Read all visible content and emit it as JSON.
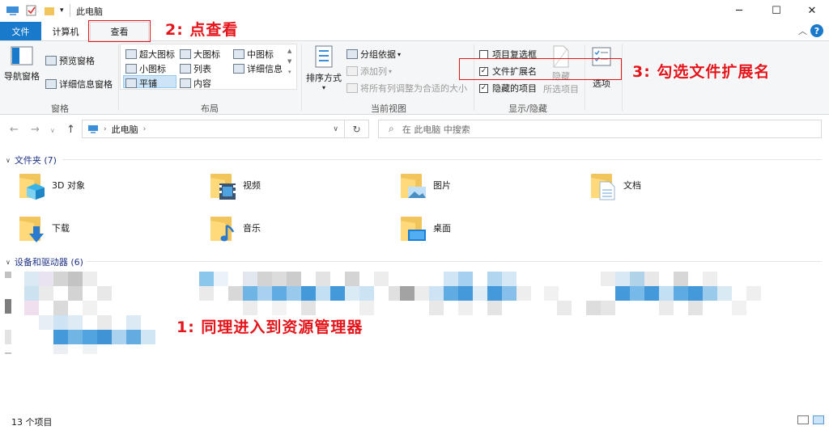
{
  "window": {
    "title": "此电脑",
    "controls": [
      "─",
      "☐",
      "✕"
    ]
  },
  "tabs": {
    "file": "文件",
    "computer": "计算机",
    "view": "查看"
  },
  "ribbon": {
    "panes": {
      "nav_pane": "导航窗格",
      "preview_pane": "预览窗格",
      "details_pane": "详细信息窗格",
      "label": "窗格"
    },
    "layout": {
      "items": [
        "超大图标",
        "大图标",
        "中图标",
        "小图标",
        "列表",
        "详细信息",
        "平铺",
        "内容"
      ],
      "label": "布局"
    },
    "current_view": {
      "sort": "排序方式",
      "group_by": "分组依据",
      "add_column": "添加列",
      "fit_columns": "将所有列调整为合适的大小",
      "label": "当前视图"
    },
    "show_hide": {
      "item_checkboxes": "项目复选框",
      "file_extensions": "文件扩展名",
      "hidden_items": "隐藏的项目",
      "hide_selected_1": "隐藏",
      "hide_selected_2": "所选项目",
      "label": "显示/隐藏"
    },
    "options": "选项"
  },
  "annotations": {
    "step1": "1:  同理进入到资源管理器",
    "step2": "2:  点查看",
    "step3": "3:  勾选文件扩展名"
  },
  "address": {
    "path": "此电脑",
    "search_placeholder": "在 此电脑 中搜索"
  },
  "folders": {
    "header": "文件夹 (7)",
    "items": [
      "3D 对象",
      "视频",
      "图片",
      "文档",
      "下载",
      "音乐",
      "桌面"
    ]
  },
  "devices": {
    "header": "设备和驱动器 (6)"
  },
  "status": {
    "count": "13 个项目"
  }
}
